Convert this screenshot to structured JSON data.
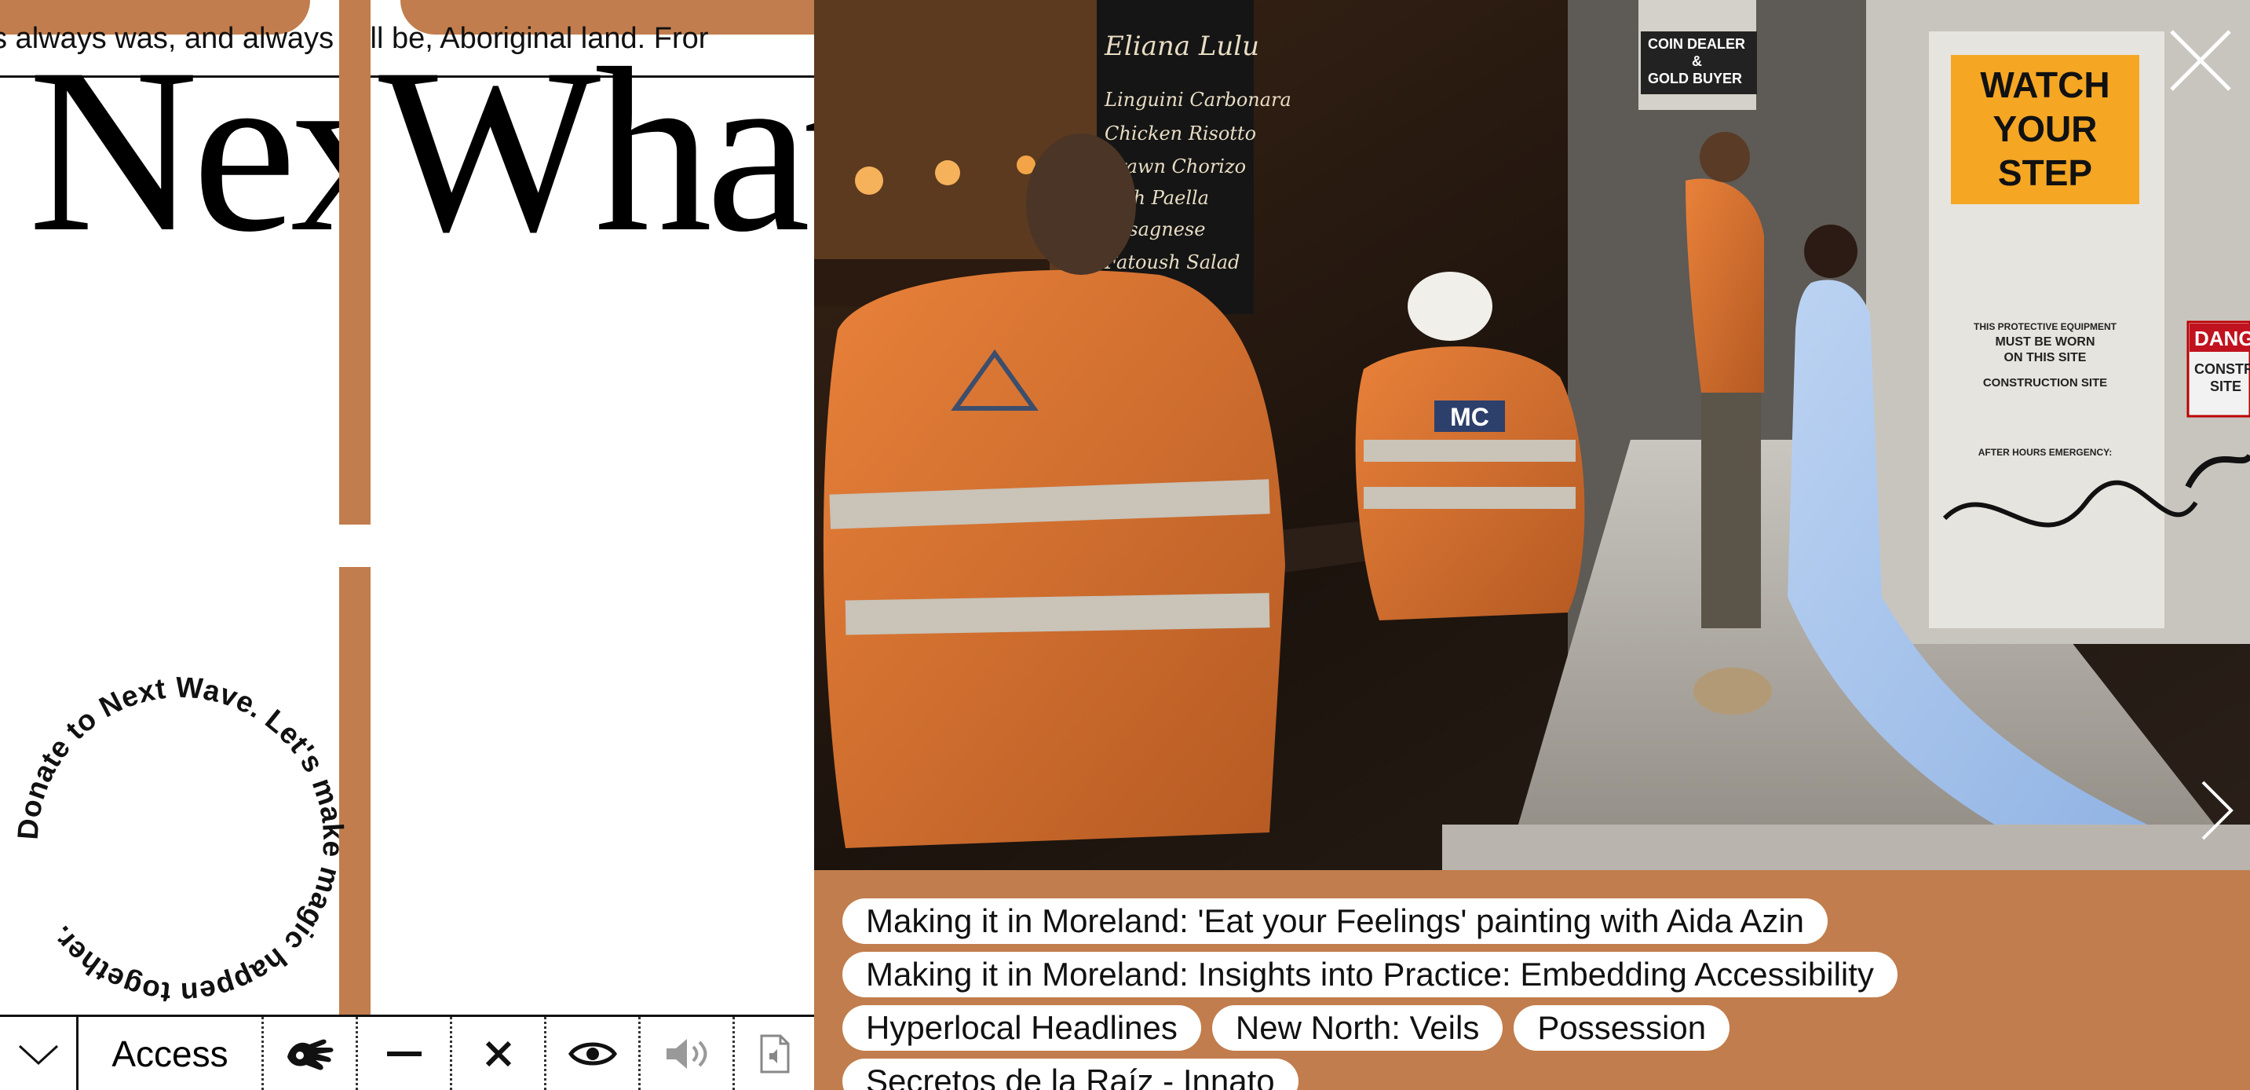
{
  "marquee": {
    "text": "s always was, and always will be, Aboriginal land. Fror"
  },
  "heading": {
    "word1": "Nex",
    "word2": "What"
  },
  "donate_ring": {
    "text": "Donate to Next Wave. Let's make magic happen together. "
  },
  "toolbar": {
    "collapse_icon": "chevron-down-icon",
    "access_label": "Access",
    "sign_icon": "sign-language-icon",
    "minus_icon": "minus-icon",
    "close_icon": "close-icon",
    "eye_icon": "eye-icon",
    "audio_icon": "speaker-icon",
    "doc_icon": "audio-document-icon"
  },
  "gallery": {
    "close_icon": "close-icon",
    "next_icon": "chevron-right-icon",
    "photo": {
      "chalkboard": [
        "Eliana Lulu",
        "Linguini Carbonara",
        "Chicken Risotto",
        "Prawn Chorizo",
        "Fish Paella",
        "Lasagnese",
        "Fatoush Salad"
      ],
      "shop_sign": [
        "COIN DEALER",
        "&",
        "GOLD BUYER"
      ],
      "warning_sign": [
        "WATCH",
        "YOUR",
        "STEP"
      ],
      "notice_lines": [
        "THIS PROTECTIVE EQUIPMENT",
        "MUST BE WORN",
        "ON THIS SITE",
        "CONSTRUCTION SITE",
        "AFTER HOURS EMERGENCY:"
      ],
      "danger_sign": [
        "DANG",
        "CONSTRUC",
        "SITE"
      ],
      "vest_logo": "MC"
    },
    "tags": [
      [
        "Making it in Moreland: 'Eat your Feelings' painting with Aida Azin"
      ],
      [
        "Making it in Moreland: Insights into Practice: Embedding Accessibility"
      ],
      [
        "Hyperlocal Headlines",
        "New North: Veils",
        "Possession"
      ],
      [
        "Secretos de la Raíz - Innato"
      ]
    ]
  },
  "colors": {
    "accent": "#c17d4d",
    "ink": "#111111",
    "paper": "#ffffff"
  }
}
